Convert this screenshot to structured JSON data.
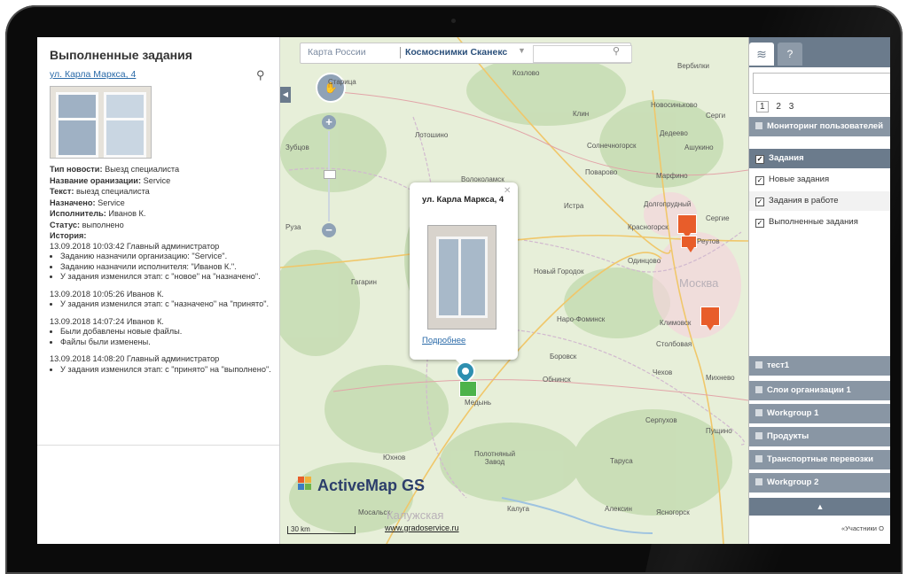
{
  "left_panel": {
    "title": "Выполненные задания",
    "address": "ул. Карла Маркса, 4",
    "fields": [
      {
        "label": "Тип новости:",
        "value": "Выезд специалиста"
      },
      {
        "label": "Название оранизации:",
        "value": "Service"
      },
      {
        "label": "Текст:",
        "value": "выезд специалиста"
      },
      {
        "label": "Назначено:",
        "value": "Service"
      },
      {
        "label": "Исполнитель:",
        "value": "Иванов К."
      },
      {
        "label": "Статус:",
        "value": "выполнено"
      }
    ],
    "history_label": "История:",
    "history": [
      {
        "header": "13.09.2018 10:03:42 Главный администратор",
        "items": [
          "Заданию назначили организацию: \"Service\".",
          "Заданию назначили исполнителя: \"Иванов К.\".",
          "У задания изменился этап: с \"новое\" на \"назначено\"."
        ]
      },
      {
        "header": "13.09.2018 10:05:26 Иванов К.",
        "items": [
          "У задания изменился этап: с \"назначено\" на \"принято\"."
        ]
      },
      {
        "header": "13.09.2018 14:07:24 Иванов К.",
        "items": [
          "Были добавлены новые файлы.",
          "Файлы были изменены."
        ]
      },
      {
        "header": "13.09.2018 14:08:20 Главный администратор",
        "items": [
          "У задания изменился этап: с \"принято\" на \"выполнено\"."
        ]
      }
    ]
  },
  "map": {
    "layer_option_1": "Карта России",
    "layer_option_2": "Космоснимки Сканекс",
    "cities": [
      "Старица",
      "Козлово",
      "Вербилки",
      "Новосиньково",
      "Клин",
      "Лотошино",
      "Солнечногорск",
      "Дедеево",
      "Ашукино",
      "Зубцов",
      "Волоколамск",
      "Поварово",
      "Марфино",
      "Истра",
      "Долгопрудный",
      "Красногорск",
      "Реутов",
      "Одинцово",
      "Гагарин",
      "Новый Городок",
      "Наро-Фоминск",
      "Климовск",
      "Столбовая",
      "Боровск",
      "Обнинск",
      "Чехов",
      "Медынь",
      "Серпухов",
      "Юхнов",
      "Полотняный Завод",
      "Таруса",
      "Калуга",
      "Алексин",
      "Ясногорск",
      "Мосальск",
      "Руза",
      "Серги",
      "Сергие",
      "Михнево",
      "Пущино"
    ],
    "region_labels": [
      "Москва",
      "Калужская"
    ],
    "popup_title": "ул. Карла Маркса, 4",
    "popup_link": "Подробнее",
    "logo_text": "ActiveMap GS",
    "scale_text": "30 km",
    "credit_link": "www.gradoservice.ru",
    "right_credit": "«Участники О"
  },
  "right_panel": {
    "pages": [
      "1",
      "2",
      "3"
    ],
    "layers": [
      {
        "label": "Мониторинг пользователей",
        "style": "dark"
      },
      {
        "label": "Задания",
        "style": "darker",
        "checked": true
      },
      {
        "label": "Новые задания",
        "style": "light",
        "checked": true
      },
      {
        "label": "Задания в работе",
        "style": "light",
        "checked": true
      },
      {
        "label": "Выполненные задания",
        "style": "light",
        "checked": true
      },
      {
        "label": "тест1",
        "style": "dark"
      },
      {
        "label": "Слои организации 1",
        "style": "dark"
      },
      {
        "label": "Workgroup 1",
        "style": "dark"
      },
      {
        "label": "Продукты",
        "style": "dark"
      },
      {
        "label": "Транспортные перевозки",
        "style": "dark"
      },
      {
        "label": "Workgroup 2",
        "style": "dark"
      }
    ],
    "up_arrow": "▲"
  },
  "colors": {
    "panel_header": "#6b7b8c",
    "link": "#2a6aa8",
    "task_marker": "#e85d2a",
    "done_marker": "#4db34a",
    "pin": "#2e8fb0"
  }
}
